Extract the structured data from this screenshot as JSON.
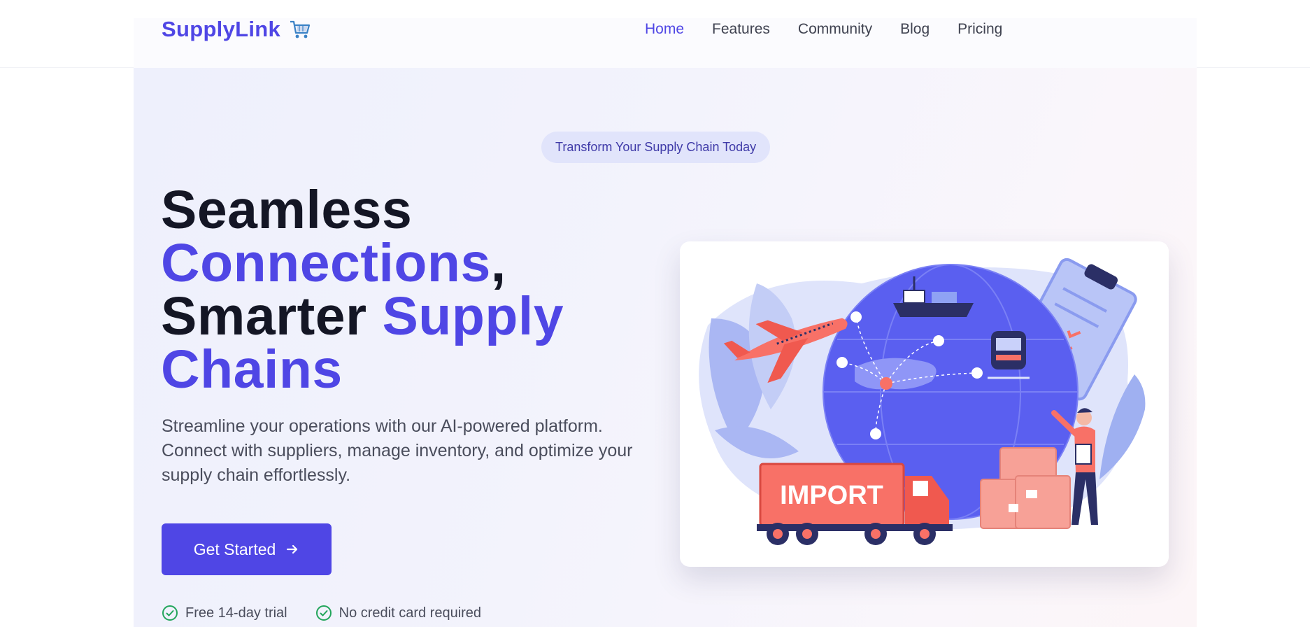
{
  "brand": {
    "name": "SupplyLink",
    "logo_icon": "shopping-cart-icon",
    "color": "#4f46e5"
  },
  "nav": {
    "items": [
      {
        "label": "Home",
        "active": true
      },
      {
        "label": "Features",
        "active": false
      },
      {
        "label": "Community",
        "active": false
      },
      {
        "label": "Blog",
        "active": false
      },
      {
        "label": "Pricing",
        "active": false
      }
    ]
  },
  "hero": {
    "badge": "Transform Your Supply Chain Today",
    "headline": {
      "line1": "Seamless",
      "line2_accent": "Connections",
      "line2_tail": ",",
      "line3_dark": "Smarter ",
      "line3_accent": "Supply",
      "line4_accent": "Chains"
    },
    "subtext": "Streamline your operations with our AI-powered platform. Connect with suppliers, manage inventory, and optimize your supply chain effortlessly.",
    "cta": {
      "label": "Get Started",
      "icon": "arrow-right-icon"
    },
    "perks": [
      {
        "label": "Free 14-day trial",
        "icon": "check-circle-icon"
      },
      {
        "label": "No credit card required",
        "icon": "check-circle-icon"
      }
    ],
    "illustration": {
      "truck_label": "IMPORT"
    }
  },
  "colors": {
    "accent": "#4f46e5",
    "dark_text": "#141625",
    "coral": "#f87167",
    "check_green": "#22a55b"
  }
}
